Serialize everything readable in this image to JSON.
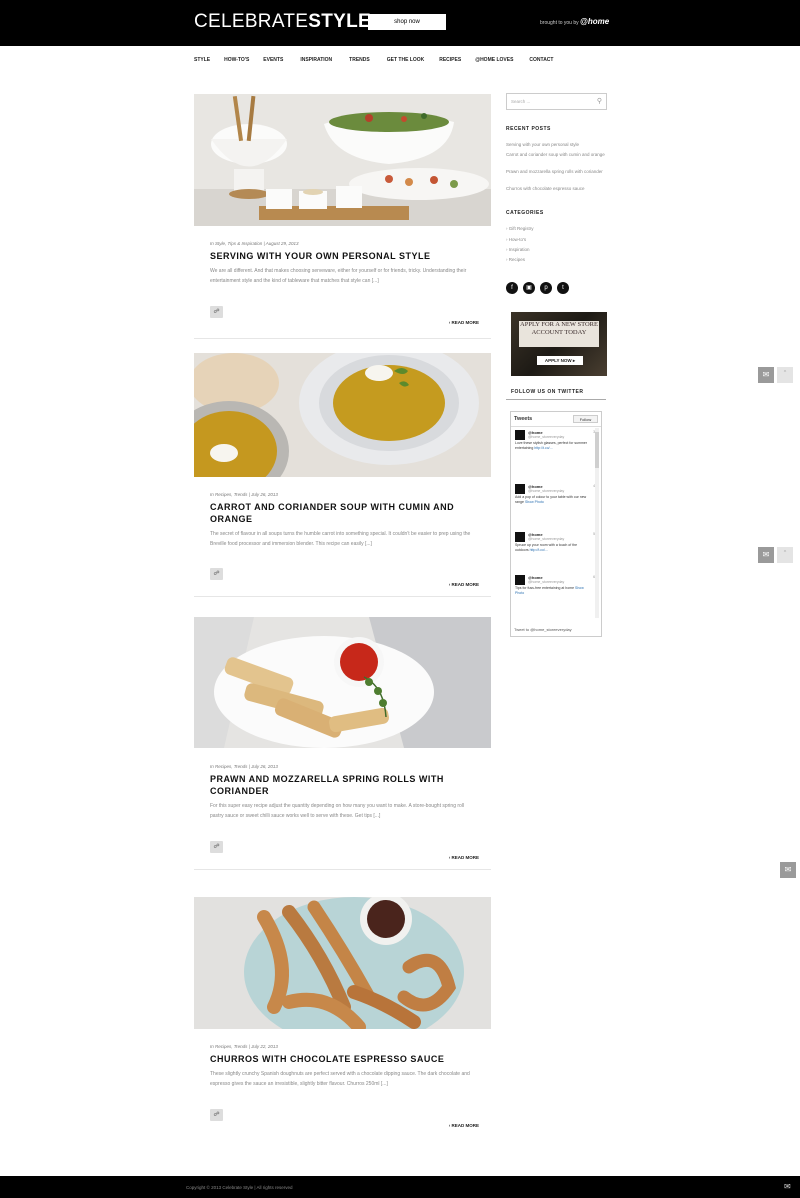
{
  "header": {
    "logo_light": "CELEBRATE",
    "logo_bold": "STYLE",
    "shop_button": "shop now",
    "brought_by": "brought to you by",
    "brand": "@home"
  },
  "nav": [
    "STYLE",
    "HOW-TO'S",
    "EVENTS",
    "INSPIRATION",
    "TRENDS",
    "GET THE LOOK",
    "RECIPES",
    "@HOME LOVES",
    "CONTACT"
  ],
  "posts": [
    {
      "meta": "In Style, Tips & Inspiration | August 29, 2013",
      "title": "SERVING WITH YOUR OWN PERSONAL STYLE",
      "excerpt": "We are all different. And that makes choosing serveware, either for yourself or for friends, tricky. Understanding their entertainment style and the kind of tableware that matches that style can [...]",
      "read_more": "READ MORE"
    },
    {
      "meta": "In Recipes, Trends | July 26, 2013",
      "title": "CARROT AND CORIANDER SOUP WITH CUMIN AND ORANGE",
      "excerpt": "The secret of flavour in all soups turns the humble carrot into something special. It couldn't be easier to prep using the Breville food processor and immersion blender. This recipe can easily [...]",
      "read_more": "READ MORE"
    },
    {
      "meta": "In Recipes, Trends | July 26, 2013",
      "title": "PRAWN AND MOZZARELLA SPRING ROLLS WITH CORIANDER",
      "excerpt": "For this super easy recipe adjust the quantity depending on how many you want to make. A store-bought spring roll pastry sauce or sweet chilli sauce works well to serve with these. Get tips [...]",
      "read_more": "READ MORE"
    },
    {
      "meta": "In Recipes, Trends | July 22, 2013",
      "title": "CHURROS WITH CHOCOLATE ESPRESSO SAUCE",
      "excerpt": "These slightly crunchy Spanish doughnuts are perfect served with a chocolate dipping sauce. The dark chocolate and espresso gives the sauce an irresistible, slightly bitter flavour. Churros 250ml [...]",
      "read_more": "READ MORE"
    }
  ],
  "sidebar": {
    "search_placeholder": "Search ...",
    "recent_heading": "RECENT POSTS",
    "recent_posts": [
      "Serving with your own personal style",
      "Carrot and coriander soup with cumin and orange",
      "Prawn and mozzarella spring rolls with coriander",
      "Churros with chocolate espresso sauce"
    ],
    "categories_heading": "CATEGORIES",
    "categories": [
      "Gift Registry",
      "How-to's",
      "Inspiration",
      "Recipes"
    ],
    "promo_text": "APPLY FOR A NEW STORE ACCOUNT TODAY",
    "promo_button": "APPLY NOW",
    "twitter_heading": "FOLLOW US ON TWITTER",
    "tweets_label": "Tweets",
    "follow_label": "Follow",
    "tweets": [
      {
        "name": "@home",
        "handle": "@home_storeeveryday",
        "time": "3h",
        "text": "Love these stylish glasses, perfect for summer entertaining",
        "link": "http://t.co/..."
      },
      {
        "name": "@home",
        "handle": "@home_storeeveryday",
        "time": "4h",
        "text": "Add a pop of colour to your table with our new range",
        "link": "Show Photo"
      },
      {
        "name": "@home",
        "handle": "@home_storeeveryday",
        "time": "5h",
        "text": "Spruce up your room with a touch of the outdoors",
        "link": "http://t.co/..."
      },
      {
        "name": "@home",
        "handle": "@home_storeeveryday",
        "time": "6h",
        "text": "Tips for fuss-free entertaining at home",
        "link": "Show Photo"
      }
    ],
    "embed_label": "Tweet to @home_storeeveryday"
  },
  "footer": {
    "copy": "Copyright © 2013 Celebrate Style | All rights reserved"
  },
  "colors": {
    "header_bg": "#000000",
    "accent": "#2a6fb0"
  }
}
